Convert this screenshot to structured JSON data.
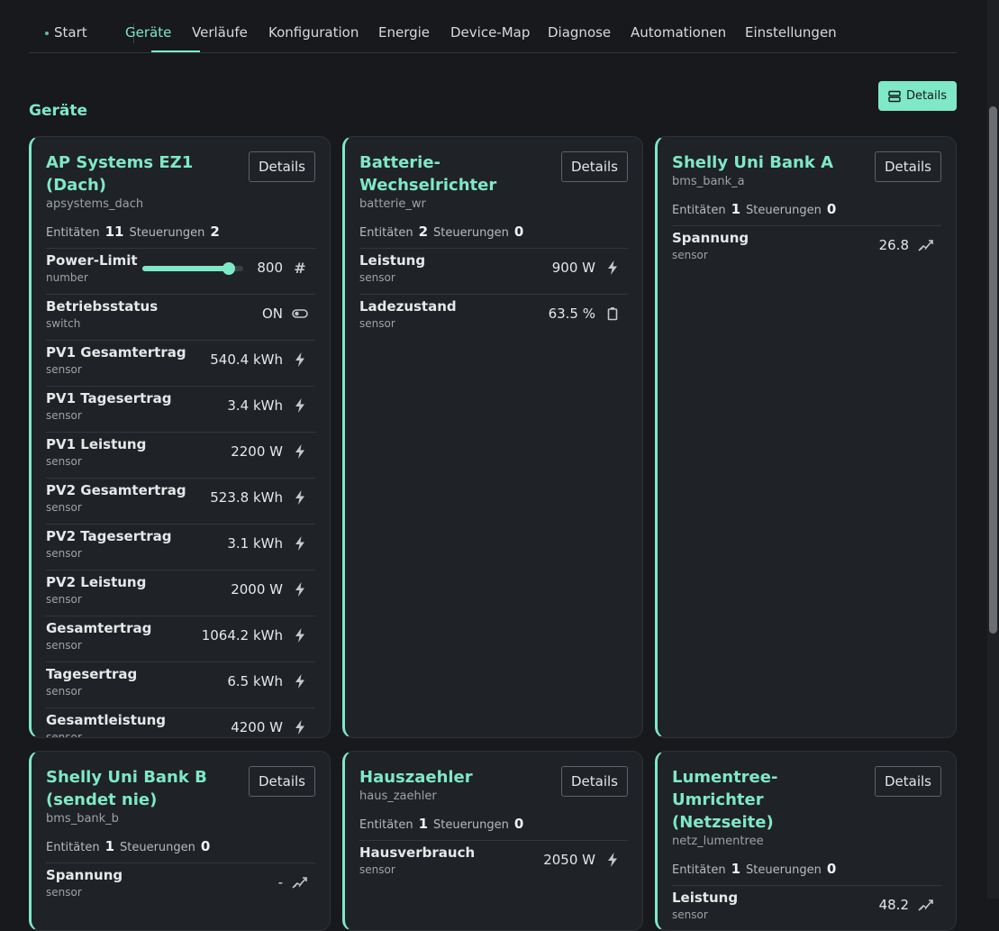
{
  "nav": {
    "tabs": [
      {
        "label": "Start"
      },
      {
        "label": "Geräte"
      },
      {
        "label": "Verläufe"
      },
      {
        "label": "Konfiguration"
      },
      {
        "label": "Energie"
      },
      {
        "label": "Device-Map"
      },
      {
        "label": "Diagnose"
      },
      {
        "label": "Automationen"
      },
      {
        "label": "Einstellungen"
      }
    ],
    "active_tab": "Geräte"
  },
  "toolbar": {
    "details_label": "Details"
  },
  "section": {
    "title": "Geräte"
  },
  "labels": {
    "entities": "Entitäten",
    "controls": "Steuerungen",
    "details": "Details"
  },
  "colors": {
    "accent": "#7fe8c6",
    "background": "#17191c",
    "card": "#1f2226"
  },
  "cards": [
    {
      "title": "AP Systems EZ1 (Dach)",
      "id": "apsystems_dach",
      "entities": "11",
      "controls": "2",
      "rows": [
        {
          "name": "Power-Limit",
          "type": "number",
          "value": "800",
          "icon": "hash-icon",
          "slider_fraction": 0.86
        },
        {
          "name": "Betriebsstatus",
          "type": "switch",
          "value": "ON",
          "icon": "toggle-icon"
        },
        {
          "name": "PV1 Gesamtertrag",
          "type": "sensor",
          "value": "540.4 kWh",
          "icon": "bolt-icon"
        },
        {
          "name": "PV1 Tagesertrag",
          "type": "sensor",
          "value": "3.4 kWh",
          "icon": "bolt-icon"
        },
        {
          "name": "PV1 Leistung",
          "type": "sensor",
          "value": "2200 W",
          "icon": "bolt-icon"
        },
        {
          "name": "PV2 Gesamtertrag",
          "type": "sensor",
          "value": "523.8 kWh",
          "icon": "bolt-icon"
        },
        {
          "name": "PV2 Tagesertrag",
          "type": "sensor",
          "value": "3.1 kWh",
          "icon": "bolt-icon"
        },
        {
          "name": "PV2 Leistung",
          "type": "sensor",
          "value": "2000 W",
          "icon": "bolt-icon"
        },
        {
          "name": "Gesamtertrag",
          "type": "sensor",
          "value": "1064.2 kWh",
          "icon": "bolt-icon"
        },
        {
          "name": "Tagesertrag",
          "type": "sensor",
          "value": "6.5 kWh",
          "icon": "bolt-icon"
        },
        {
          "name": "Gesamtleistung",
          "type": "sensor",
          "value": "4200 W",
          "icon": "bolt-icon"
        }
      ]
    },
    {
      "title": "Batterie-Wechselrichter",
      "id": "batterie_wr",
      "entities": "2",
      "controls": "0",
      "rows": [
        {
          "name": "Leistung",
          "type": "sensor",
          "value": "900 W",
          "icon": "bolt-icon"
        },
        {
          "name": "Ladezustand",
          "type": "sensor",
          "value": "63.5 %",
          "icon": "battery-icon"
        }
      ]
    },
    {
      "title": "Shelly Uni Bank A",
      "id": "bms_bank_a",
      "entities": "1",
      "controls": "0",
      "rows": [
        {
          "name": "Spannung",
          "type": "sensor",
          "value": "26.8",
          "icon": "trend-icon"
        }
      ]
    },
    {
      "title": "Shelly Uni Bank B (sendet nie)",
      "id": "bms_bank_b",
      "entities": "1",
      "controls": "0",
      "rows": [
        {
          "name": "Spannung",
          "type": "sensor",
          "value": "-",
          "icon": "trend-icon"
        }
      ]
    },
    {
      "title": "Hauszaehler",
      "id": "haus_zaehler",
      "entities": "1",
      "controls": "0",
      "rows": [
        {
          "name": "Hausverbrauch",
          "type": "sensor",
          "value": "2050 W",
          "icon": "bolt-icon"
        }
      ]
    },
    {
      "title": "Lumentree-Umrichter (Netzseite)",
      "id": "netz_lumentree",
      "entities": "1",
      "controls": "0",
      "rows": [
        {
          "name": "Leistung",
          "type": "sensor",
          "value": "48.2",
          "icon": "trend-icon"
        }
      ]
    }
  ]
}
